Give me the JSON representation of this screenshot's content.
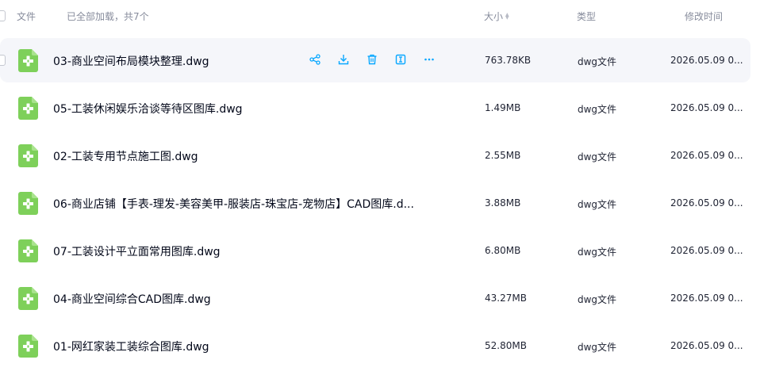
{
  "header": {
    "file_label": "文件",
    "loaded_label": "已全部加载，共7个",
    "size_label": "大小",
    "type_label": "类型",
    "mtime_label": "修改时间"
  },
  "colors": {
    "accent": "#06a7ff",
    "file_icon_green": "#7ed05a",
    "row_hover_bg": "#f5f6fa",
    "muted_text": "#878c9c"
  },
  "files": [
    {
      "name": "03-商业空间布局模块整理.dwg",
      "size": "763.78KB",
      "type": "dwg文件",
      "mtime": "2026.05.09 0...",
      "icon": "dwg-file-icon",
      "hovered": true
    },
    {
      "name": "05-工装休闲娱乐洽谈等待区图库.dwg",
      "size": "1.49MB",
      "type": "dwg文件",
      "mtime": "2026.05.09 0...",
      "icon": "dwg-file-icon"
    },
    {
      "name": "02-工装专用节点施工图.dwg",
      "size": "2.55MB",
      "type": "dwg文件",
      "mtime": "2026.05.09 0...",
      "icon": "dwg-file-icon"
    },
    {
      "name": "06-商业店铺【手表-理发-美容美甲-服装店-珠宝店-宠物店】CAD图库.d...",
      "size": "3.88MB",
      "type": "dwg文件",
      "mtime": "2026.05.09 0...",
      "icon": "dwg-file-icon"
    },
    {
      "name": "07-工装设计平立面常用图库.dwg",
      "size": "6.80MB",
      "type": "dwg文件",
      "mtime": "2026.05.09 0...",
      "icon": "dwg-file-icon"
    },
    {
      "name": "04-商业空间综合CAD图库.dwg",
      "size": "43.27MB",
      "type": "dwg文件",
      "mtime": "2026.05.09 0...",
      "icon": "dwg-file-icon"
    },
    {
      "name": "01-网红家装工装综合图库.dwg",
      "size": "52.80MB",
      "type": "dwg文件",
      "mtime": "2026.05.09 0...",
      "icon": "dwg-file-icon"
    }
  ],
  "row_actions": [
    "share-icon",
    "download-icon",
    "delete-icon",
    "rename-icon",
    "more-icon"
  ]
}
